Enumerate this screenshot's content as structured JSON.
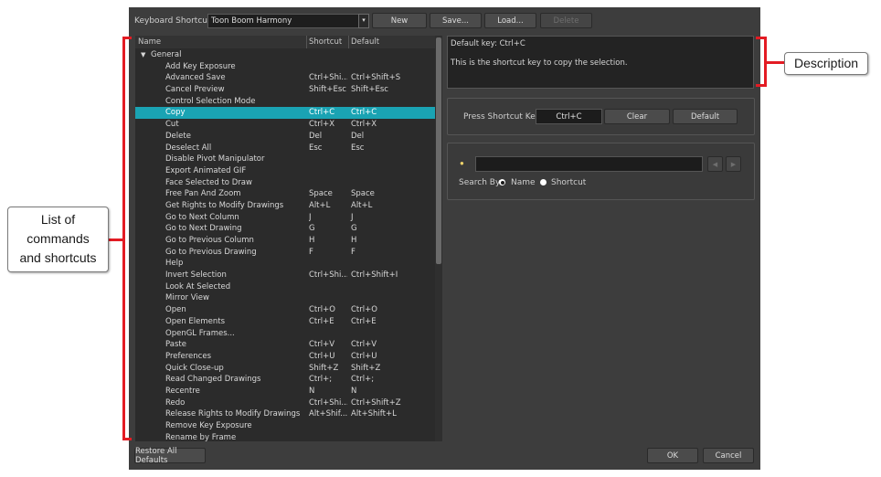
{
  "toolbar": {
    "label": "Keyboard Shortcuts:",
    "set_value": "Toon Boom Harmony",
    "dropdown_arrow": "▾",
    "new_label": "New",
    "save_label": "Save...",
    "load_label": "Load...",
    "delete_label": "Delete"
  },
  "tree": {
    "headers": {
      "name": "Name",
      "shortcut": "Shortcut",
      "default": "Default"
    },
    "group_label": "General",
    "rows": [
      {
        "name": "Add Key Exposure",
        "shortcut": "",
        "default": ""
      },
      {
        "name": "Advanced Save",
        "shortcut": "Ctrl+Shi...",
        "default": "Ctrl+Shift+S"
      },
      {
        "name": "Cancel Preview",
        "shortcut": "Shift+Esc",
        "default": "Shift+Esc"
      },
      {
        "name": "Control Selection Mode",
        "shortcut": "",
        "default": ""
      },
      {
        "name": "Copy",
        "shortcut": "Ctrl+C",
        "default": "Ctrl+C"
      },
      {
        "name": "Cut",
        "shortcut": "Ctrl+X",
        "default": "Ctrl+X"
      },
      {
        "name": "Delete",
        "shortcut": "Del",
        "default": "Del"
      },
      {
        "name": "Deselect All",
        "shortcut": "Esc",
        "default": "Esc"
      },
      {
        "name": "Disable Pivot Manipulator",
        "shortcut": "",
        "default": ""
      },
      {
        "name": "Export Animated GIF",
        "shortcut": "",
        "default": ""
      },
      {
        "name": "Face Selected to Draw",
        "shortcut": "",
        "default": ""
      },
      {
        "name": "Free Pan And Zoom",
        "shortcut": "Space",
        "default": "Space"
      },
      {
        "name": "Get Rights to Modify Drawings",
        "shortcut": "Alt+L",
        "default": "Alt+L"
      },
      {
        "name": "Go to Next Column",
        "shortcut": "J",
        "default": "J"
      },
      {
        "name": "Go to Next Drawing",
        "shortcut": "G",
        "default": "G"
      },
      {
        "name": "Go to Previous Column",
        "shortcut": "H",
        "default": "H"
      },
      {
        "name": "Go to Previous Drawing",
        "shortcut": "F",
        "default": "F"
      },
      {
        "name": "Help",
        "shortcut": "",
        "default": ""
      },
      {
        "name": "Invert Selection",
        "shortcut": "Ctrl+Shi...",
        "default": "Ctrl+Shift+I"
      },
      {
        "name": "Look At Selected",
        "shortcut": "",
        "default": ""
      },
      {
        "name": "Mirror View",
        "shortcut": "",
        "default": ""
      },
      {
        "name": "Open",
        "shortcut": "Ctrl+O",
        "default": "Ctrl+O"
      },
      {
        "name": "Open Elements",
        "shortcut": "Ctrl+E",
        "default": "Ctrl+E"
      },
      {
        "name": "OpenGL Frames...",
        "shortcut": "",
        "default": ""
      },
      {
        "name": "Paste",
        "shortcut": "Ctrl+V",
        "default": "Ctrl+V"
      },
      {
        "name": "Preferences",
        "shortcut": "Ctrl+U",
        "default": "Ctrl+U"
      },
      {
        "name": "Quick Close-up",
        "shortcut": "Shift+Z",
        "default": "Shift+Z"
      },
      {
        "name": "Read Changed Drawings",
        "shortcut": "Ctrl+;",
        "default": "Ctrl+;"
      },
      {
        "name": "Recentre",
        "shortcut": "N",
        "default": "N"
      },
      {
        "name": "Redo",
        "shortcut": "Ctrl+Shi...",
        "default": "Ctrl+Shift+Z"
      },
      {
        "name": "Release Rights to Modify Drawings",
        "shortcut": "Alt+Shif...",
        "default": "Alt+Shift+L"
      },
      {
        "name": "Remove Key Exposure",
        "shortcut": "",
        "default": ""
      },
      {
        "name": "Rename by Frame",
        "shortcut": "",
        "default": ""
      }
    ]
  },
  "description": {
    "default_key": "Default key: Ctrl+C",
    "text": "This is the shortcut key to copy the selection."
  },
  "shortcut_editor": {
    "label": "Press Shortcut Key:",
    "value": "Ctrl+C",
    "clear_label": "Clear",
    "default_label": "Default"
  },
  "search": {
    "value": "",
    "prev_icon": "◀",
    "next_icon": "▶",
    "search_by_label": "Search By:",
    "option_name": "Name",
    "option_shortcut": "Shortcut",
    "selected": "Name"
  },
  "footer": {
    "restore_label": "Restore All Defaults",
    "ok_label": "OK",
    "cancel_label": "Cancel"
  },
  "callouts": {
    "description": "Description",
    "list": [
      "List of",
      "commands",
      "and shortcuts"
    ]
  },
  "colors": {
    "accent": "#e31b23",
    "selection": "#1aa3b3",
    "dialog_bg": "#3d3d3d"
  }
}
